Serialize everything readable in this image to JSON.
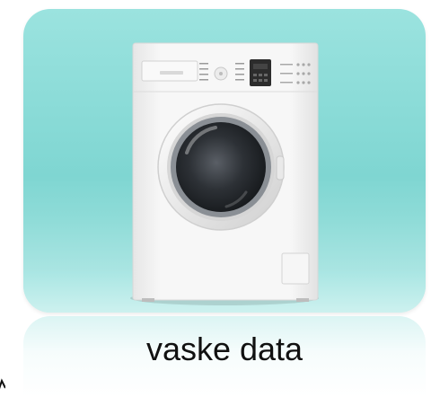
{
  "caption": "vaske data",
  "colors": {
    "tile_background": "#8ddbd7",
    "machine_body": "#f4f4f4",
    "caption_text": "#111111"
  },
  "icons": [
    "washing-machine-icon"
  ]
}
